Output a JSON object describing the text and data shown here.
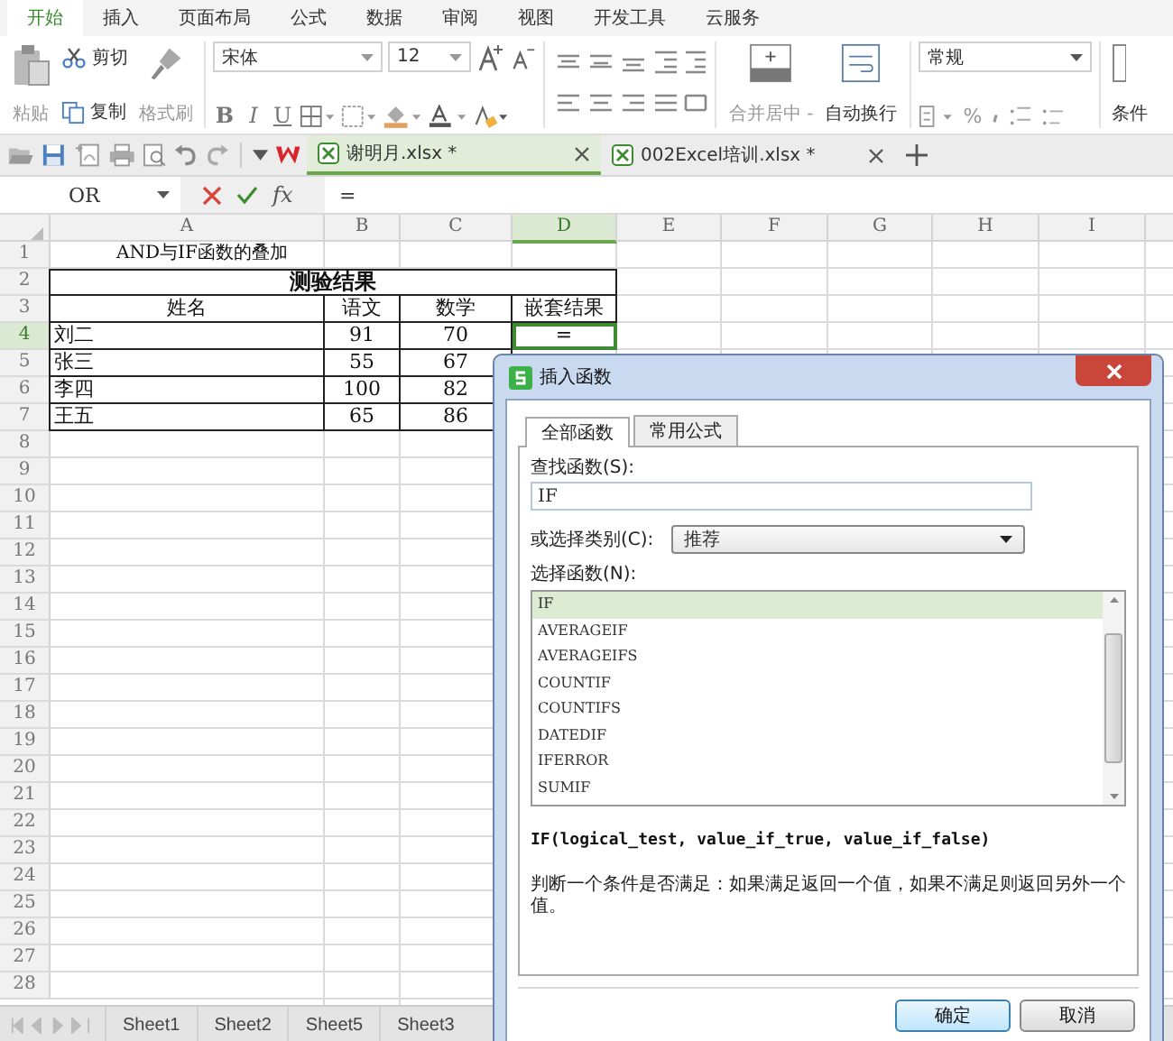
{
  "ribbon_tabs": [
    {
      "label": "开始",
      "selected": true
    },
    {
      "label": "插入",
      "selected": false
    },
    {
      "label": "页面布局",
      "selected": false
    },
    {
      "label": "公式",
      "selected": false
    },
    {
      "label": "数据",
      "selected": false
    },
    {
      "label": "审阅",
      "selected": false
    },
    {
      "label": "视图",
      "selected": false
    },
    {
      "label": "开发工具",
      "selected": false
    },
    {
      "label": "云服务",
      "selected": false
    }
  ],
  "ribbon": {
    "paste": "粘贴",
    "cut": "剪切",
    "copy": "复制",
    "format_painter": "格式刷",
    "font": "宋体",
    "font_size": "12",
    "bold": "B",
    "italic": "I",
    "underline": "U",
    "merge_center": "合并居中 -",
    "wrap_text": "自动换行",
    "number_format": "常规",
    "percent": "%",
    "conditional": "条件"
  },
  "doc_tabs": [
    {
      "label": "谢明月.xlsx *",
      "selected": true
    },
    {
      "label": "002Excel培训.xlsx *",
      "selected": false
    }
  ],
  "formula_bar": {
    "name_box": "OR",
    "fx": "fx",
    "value": "="
  },
  "sheet": {
    "columns": [
      {
        "label": "A",
        "selected": false
      },
      {
        "label": "B",
        "selected": false
      },
      {
        "label": "C",
        "selected": false
      },
      {
        "label": "D",
        "selected": true
      },
      {
        "label": "E",
        "selected": false
      },
      {
        "label": "F",
        "selected": false
      },
      {
        "label": "G",
        "selected": false
      },
      {
        "label": "H",
        "selected": false
      },
      {
        "label": "I",
        "selected": false
      }
    ],
    "rows": [
      {
        "number": "1",
        "selected": false,
        "cells": [
          {
            "kind": "title",
            "text": "AND与IF函数的叠加"
          }
        ]
      },
      {
        "number": "2",
        "selected": false,
        "cells": [
          {
            "kind": "merged",
            "text": "测验结果"
          }
        ]
      },
      {
        "number": "3",
        "selected": false,
        "cells": [
          {
            "kind": "center",
            "text": "姓名"
          },
          {
            "kind": "center",
            "text": "语文"
          },
          {
            "kind": "center",
            "text": "数学"
          },
          {
            "kind": "center",
            "text": "嵌套结果"
          }
        ]
      },
      {
        "number": "4",
        "selected": true,
        "cells": [
          {
            "kind": "left",
            "text": "刘二"
          },
          {
            "kind": "center",
            "text": "91"
          },
          {
            "kind": "center",
            "text": "70"
          },
          {
            "kind": "active",
            "text": "="
          }
        ]
      },
      {
        "number": "5",
        "selected": false,
        "cells": [
          {
            "kind": "left",
            "text": "张三"
          },
          {
            "kind": "center",
            "text": "55"
          },
          {
            "kind": "center",
            "text": "67"
          }
        ]
      },
      {
        "number": "6",
        "selected": false,
        "cells": [
          {
            "kind": "left",
            "text": "李四"
          },
          {
            "kind": "center",
            "text": "100"
          },
          {
            "kind": "center",
            "text": "82"
          }
        ]
      },
      {
        "number": "7",
        "selected": false,
        "cells": [
          {
            "kind": "left",
            "text": "王五"
          },
          {
            "kind": "center",
            "text": "65"
          },
          {
            "kind": "center",
            "text": "86"
          }
        ]
      },
      {
        "number": "8",
        "selected": false
      },
      {
        "number": "9",
        "selected": false
      },
      {
        "number": "10",
        "selected": false
      },
      {
        "number": "11",
        "selected": false
      },
      {
        "number": "12",
        "selected": false
      },
      {
        "number": "13",
        "selected": false
      },
      {
        "number": "14",
        "selected": false
      },
      {
        "number": "15",
        "selected": false
      },
      {
        "number": "16",
        "selected": false
      },
      {
        "number": "17",
        "selected": false
      },
      {
        "number": "18",
        "selected": false
      },
      {
        "number": "19",
        "selected": false
      },
      {
        "number": "20",
        "selected": false
      },
      {
        "number": "21",
        "selected": false
      },
      {
        "number": "22",
        "selected": false
      },
      {
        "number": "23",
        "selected": false
      },
      {
        "number": "24",
        "selected": false
      },
      {
        "number": "25",
        "selected": false
      },
      {
        "number": "26",
        "selected": false
      },
      {
        "number": "27",
        "selected": false
      },
      {
        "number": "28",
        "selected": false
      }
    ]
  },
  "sheet_tabs": [
    "Sheet1",
    "Sheet2",
    "Sheet5",
    "Sheet3"
  ],
  "dialog": {
    "title": "插入函数",
    "tabs": [
      {
        "label": "全部函数",
        "selected": true
      },
      {
        "label": "常用公式",
        "selected": false
      }
    ],
    "search_label": "查找函数(S):",
    "search_value": "IF",
    "category_label": "或选择类别(C):",
    "category": "推荐",
    "list_label": "选择函数(N):",
    "functions": [
      {
        "name": "IF",
        "selected": true
      },
      {
        "name": "AVERAGEIF",
        "selected": false
      },
      {
        "name": "AVERAGEIFS",
        "selected": false
      },
      {
        "name": "COUNTIF",
        "selected": false
      },
      {
        "name": "COUNTIFS",
        "selected": false
      },
      {
        "name": "DATEDIF",
        "selected": false
      },
      {
        "name": "IFERROR",
        "selected": false
      },
      {
        "name": "SUMIF",
        "selected": false
      }
    ],
    "signature": "IF(logical_test, value_if_true, value_if_false)",
    "description": "判断一个条件是否满足：如果满足返回一个值，如果不满足则返回另外一个值。",
    "buttons": [
      {
        "label": "确定",
        "kind": "primary"
      },
      {
        "label": "取消",
        "kind": "secondary"
      }
    ]
  }
}
